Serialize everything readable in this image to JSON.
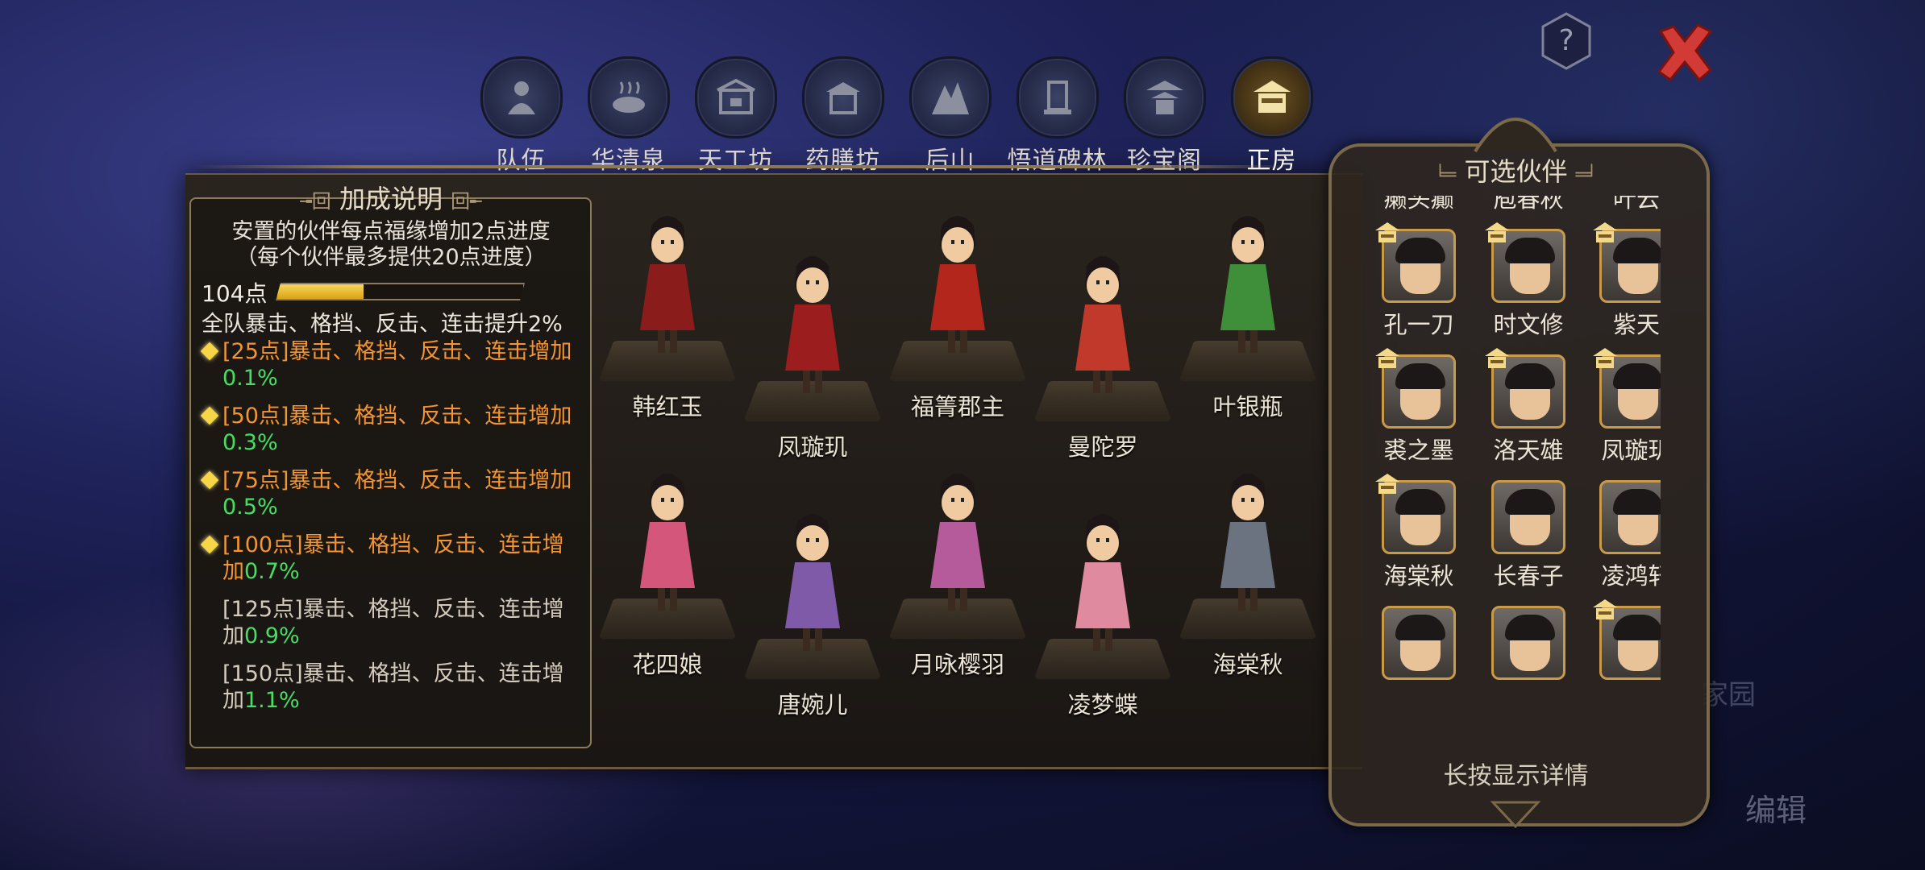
{
  "tabs": [
    {
      "label": "队伍",
      "icon": "team-icon",
      "active": false
    },
    {
      "label": "华清泉",
      "icon": "hot-spring-icon",
      "active": false
    },
    {
      "label": "天工坊",
      "icon": "workshop-icon",
      "active": false
    },
    {
      "label": "药膳坊",
      "icon": "kitchen-icon",
      "active": false
    },
    {
      "label": "后山",
      "icon": "mountain-icon",
      "active": false
    },
    {
      "label": "悟道碑林",
      "icon": "stele-icon",
      "active": false
    },
    {
      "label": "珍宝阁",
      "icon": "pavilion-icon",
      "active": false
    },
    {
      "label": "正房",
      "icon": "main-house-icon",
      "active": true
    }
  ],
  "bonus": {
    "title": "加成说明",
    "desc_line1": "安置的伙伴每点福缘增加2点进度",
    "desc_line2": "（每个伙伴最多提供20点进度）",
    "points_label": "104点",
    "progress_fraction": 0.35,
    "team_bonus": "全队暴击、格挡、反击、连击提升2%",
    "tiers": [
      {
        "text": "[25点]暴击、格挡、反击、连击增加",
        "value": "0.1%",
        "reached": true
      },
      {
        "text": "[50点]暴击、格挡、反击、连击增加",
        "value": "0.3%",
        "reached": true
      },
      {
        "text": "[75点]暴击、格挡、反击、连击增加",
        "value": "0.5%",
        "reached": true
      },
      {
        "text": "[100点]暴击、格挡、反击、连击增加",
        "value": "0.7%",
        "reached": true
      },
      {
        "text": "[125点]暴击、格挡、反击、连击增加",
        "value": "0.9%",
        "reached": false
      },
      {
        "text": "[150点]暴击、格挡、反击、连击增加",
        "value": "1.1%",
        "reached": false
      }
    ]
  },
  "placed_characters": [
    {
      "name": "韩红玉",
      "color": "#8a1c1c"
    },
    {
      "name": "凤璇玑",
      "color": "#9b1d1d"
    },
    {
      "name": "福箐郡主",
      "color": "#b3261c"
    },
    {
      "name": "曼陀罗",
      "color": "#c0392b"
    },
    {
      "name": "叶银瓶",
      "color": "#3f8f3a"
    },
    {
      "name": "花四娘",
      "color": "#d4567a"
    },
    {
      "name": "唐婉儿",
      "color": "#7e5aa8"
    },
    {
      "name": "月咏樱羽",
      "color": "#b55a9a"
    },
    {
      "name": "凌梦蝶",
      "color": "#e08aa0"
    },
    {
      "name": "海棠秋",
      "color": "#6b7380"
    }
  ],
  "partners_panel": {
    "title": "可选伙伴",
    "hint": "长按显示详情",
    "partners": [
      {
        "name": "癞头癫",
        "badge": false
      },
      {
        "name": "庖春秋",
        "badge": false
      },
      {
        "name": "叶云",
        "badge": false
      },
      {
        "name": "孔一刀",
        "badge": true
      },
      {
        "name": "时文修",
        "badge": true
      },
      {
        "name": "紫天",
        "badge": true
      },
      {
        "name": "裘之墨",
        "badge": true
      },
      {
        "name": "洛天雄",
        "badge": true
      },
      {
        "name": "凤璇玑",
        "badge": true
      },
      {
        "name": "海棠秋",
        "badge": true
      },
      {
        "name": "长春子",
        "badge": false
      },
      {
        "name": "凌鸿轩",
        "badge": false
      },
      {
        "name": "",
        "badge": false
      },
      {
        "name": "",
        "badge": false
      },
      {
        "name": "",
        "badge": true
      }
    ]
  },
  "edit_label": "编辑"
}
